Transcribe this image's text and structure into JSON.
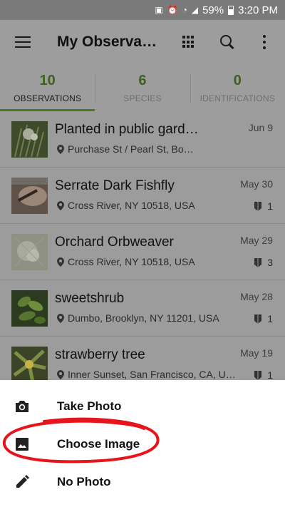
{
  "status_bar": {
    "battery": "59%",
    "time": "3:20 PM"
  },
  "app_bar": {
    "title": "My Observati…"
  },
  "tabs": [
    {
      "count": "10",
      "label": "OBSERVATIONS",
      "active": true
    },
    {
      "count": "6",
      "label": "SPECIES",
      "active": false
    },
    {
      "count": "0",
      "label": "IDENTIFICATIONS",
      "active": false
    }
  ],
  "observations": [
    {
      "title": "Planted in public gard…",
      "location": "Purchase St / Pearl St, Bo…",
      "date": "Jun 9",
      "ids": ""
    },
    {
      "title": "Serrate Dark Fishfly",
      "location": "Cross River, NY 10518, USA",
      "date": "May 30",
      "ids": "1"
    },
    {
      "title": "Orchard Orbweaver",
      "location": "Cross River, NY 10518, USA",
      "date": "May 29",
      "ids": "3"
    },
    {
      "title": "sweetshrub",
      "location": "Dumbo, Brooklyn, NY 11201, USA",
      "date": "May 28",
      "ids": "1"
    },
    {
      "title": "strawberry tree",
      "location": "Inner Sunset, San Francisco, CA, U…",
      "date": "May 19",
      "ids": "1"
    }
  ],
  "sheet": {
    "take_photo": "Take Photo",
    "choose_image": "Choose Image",
    "no_photo": "No Photo"
  },
  "colors": {
    "accent_green": "#4a7a1e",
    "annotation_red": "#e8141b"
  }
}
